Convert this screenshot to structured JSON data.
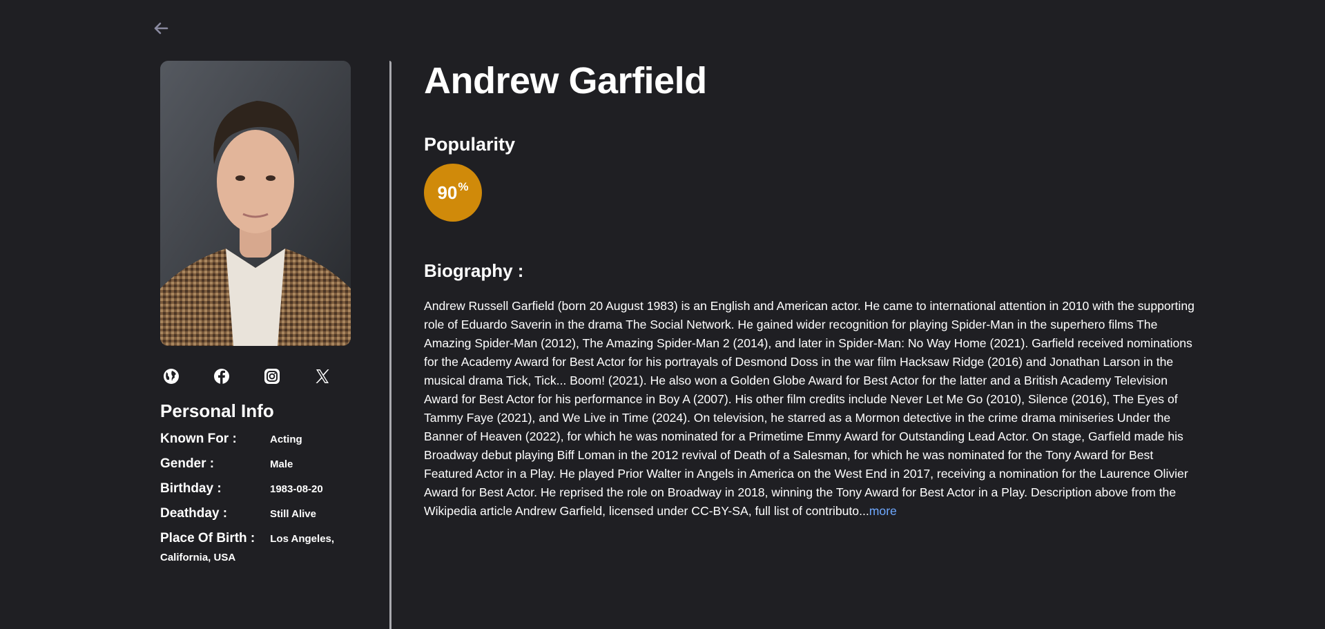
{
  "person": {
    "name": "Andrew Garfield",
    "portrait_alt": "Andrew Garfield portrait"
  },
  "popularity": {
    "title": "Popularity",
    "value": "90",
    "unit": "%",
    "badge_color": "#d08a0a"
  },
  "biography": {
    "title": "Biography :",
    "text": "Andrew Russell Garfield (born 20 August 1983) is an English and American actor. He came to international attention in 2010 with the supporting role of Eduardo Saverin in the drama The Social Network. He gained wider recognition for playing Spider-Man in the superhero films The Amazing Spider-Man (2012), The Amazing Spider-Man 2 (2014), and later in Spider-Man: No Way Home (2021). Garfield received nominations for the Academy Award for Best Actor for his portrayals of Desmond Doss in the war film Hacksaw Ridge (2016) and Jonathan Larson in the musical drama Tick, Tick... Boom! (2021). He also won a Golden Globe Award for Best Actor for the latter and a British Academy Television Award for Best Actor for his performance in Boy A (2007). His other film credits include Never Let Me Go (2010), Silence (2016), The Eyes of Tammy Faye (2021), and We Live in Time (2024). On television, he starred as a Mormon detective in the crime drama miniseries Under the Banner of Heaven (2022), for which he was nominated for a Primetime Emmy Award for Outstanding Lead Actor. On stage, Garfield made his Broadway debut playing Biff Loman in the 2012 revival of Death of a Salesman, for which he was nominated for the Tony Award for Best Featured Actor in a Play. He played Prior Walter in Angels in America on the West End in 2017, receiving a nomination for the Laurence Olivier Award for Best Actor. He reprised the role on Broadway in 2018, winning the Tony Award for Best Actor in a Play. Description above from the Wikipedia article Andrew Garfield, licensed under CC-BY-SA, full list of contributo...",
    "more_label": "more",
    "link_color": "#6ea8ff"
  },
  "socials": [
    {
      "icon": "globe-icon"
    },
    {
      "icon": "facebook-icon"
    },
    {
      "icon": "instagram-icon"
    },
    {
      "icon": "x-icon"
    }
  ],
  "personal_info": {
    "title": "Personal Info",
    "known_for": {
      "label": "Known For :",
      "value": "Acting"
    },
    "gender": {
      "label": "Gender :",
      "value": "Male"
    },
    "birthday": {
      "label": "Birthday :",
      "value": "1983-08-20"
    },
    "deathday": {
      "label": "Deathday :",
      "value": "Still Alive"
    },
    "place_of_birth": {
      "label": "Place Of Birth :",
      "value_line1": "Los Angeles,",
      "value_line2": "California, USA"
    }
  },
  "navigation": {
    "back_icon": "arrow-left-icon"
  },
  "colors": {
    "background": "#1f1f23",
    "divider": "#a9a9ae"
  }
}
